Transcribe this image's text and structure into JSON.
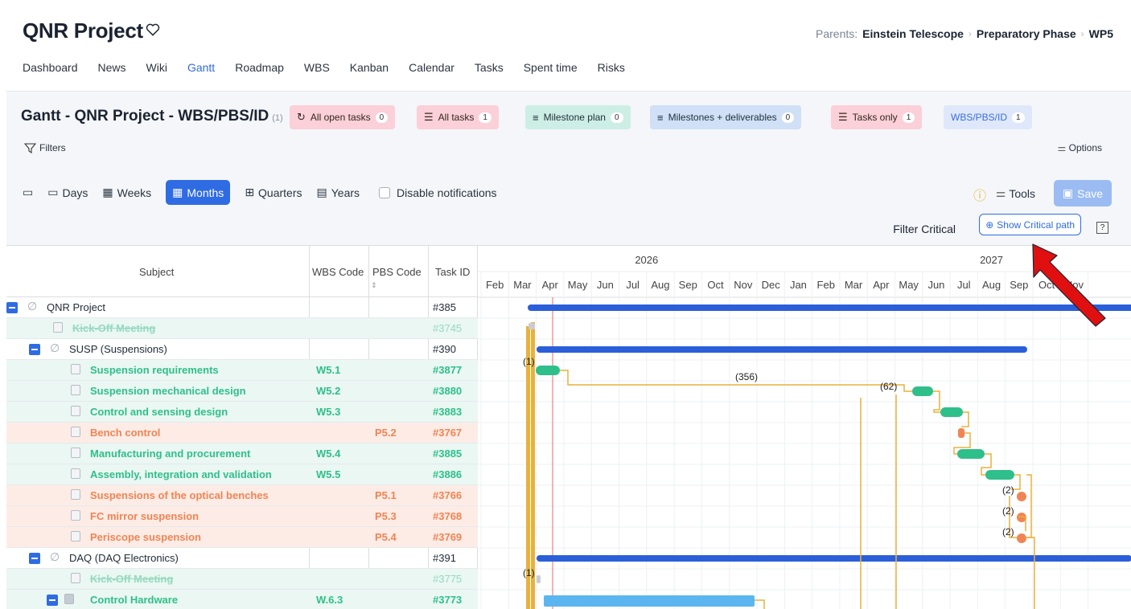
{
  "project": {
    "title": "QNR Project"
  },
  "parents": {
    "label": "Parents:",
    "items": [
      "Einstein Telescope",
      "Preparatory Phase",
      "WP5"
    ]
  },
  "nav": [
    "Dashboard",
    "News",
    "Wiki",
    "Gantt",
    "Roadmap",
    "WBS",
    "Kanban",
    "Calendar",
    "Tasks",
    "Spent time",
    "Risks"
  ],
  "nav_active": "Gantt",
  "gantt": {
    "title": "Gantt - QNR Project - WBS/PBS/ID",
    "title_count": "(1)",
    "queries": [
      {
        "label": "All open tasks",
        "count": "0",
        "style": "pink",
        "icon": "refresh-icon"
      },
      {
        "label": "All tasks",
        "count": "1",
        "style": "pink",
        "icon": "list-icon"
      },
      {
        "label": "Milestone plan",
        "count": "0",
        "style": "mint",
        "icon": "filter-list-icon"
      },
      {
        "label": "Milestones + deliverables",
        "count": "0",
        "style": "blue",
        "icon": "filter-list-icon"
      },
      {
        "label": "Tasks only",
        "count": "1",
        "style": "pink",
        "icon": "list-icon"
      },
      {
        "label": "WBS/PBS/ID",
        "count": "1",
        "style": "wbs",
        "icon": ""
      }
    ],
    "filters_label": "Filters",
    "options_label": "Options",
    "zoom": {
      "days": "Days",
      "weeks": "Weeks",
      "months": "Months",
      "quarters": "Quarters",
      "years": "Years",
      "active": "Months"
    },
    "disable_notifications": "Disable notifications",
    "tools_label": "Tools",
    "save_label": "Save",
    "filter_critical": "Filter Critical",
    "show_critical": "Show Critical path",
    "help": "?",
    "columns": {
      "subject": "Subject",
      "wbs": "WBS Code",
      "pbs": "PBS Code",
      "task_id": "Task ID"
    },
    "years": [
      "2026",
      "2027"
    ],
    "months": [
      "Feb",
      "Mar",
      "Apr",
      "May",
      "Jun",
      "Jul",
      "Aug",
      "Sep",
      "Oct",
      "Nov",
      "Dec",
      "Jan",
      "Feb",
      "Mar",
      "Apr",
      "May",
      "Jun",
      "Jul",
      "Aug",
      "Sep",
      "Oct",
      "Nov"
    ],
    "rows": [
      {
        "subject": "QNR Project",
        "wbs": "",
        "pbs": "",
        "id": "#385",
        "level": 0,
        "kind": "parent",
        "style": "plain"
      },
      {
        "subject": "Kick-Off Meeting",
        "wbs": "",
        "pbs": "",
        "id": "#3745",
        "level": 1,
        "kind": "task",
        "style": "strike"
      },
      {
        "subject": "SUSP (Suspensions)",
        "wbs": "",
        "pbs": "",
        "id": "#390",
        "level": 1,
        "kind": "parent",
        "style": "plain"
      },
      {
        "subject": "Suspension requirements",
        "wbs": "W5.1",
        "pbs": "",
        "id": "#3877",
        "level": 2,
        "kind": "task",
        "style": "green"
      },
      {
        "subject": "Suspension mechanical design",
        "wbs": "W5.2",
        "pbs": "",
        "id": "#3880",
        "level": 2,
        "kind": "task",
        "style": "green"
      },
      {
        "subject": "Control and sensing design",
        "wbs": "W5.3",
        "pbs": "",
        "id": "#3883",
        "level": 2,
        "kind": "task",
        "style": "green"
      },
      {
        "subject": "Bench control",
        "wbs": "",
        "pbs": "P5.2",
        "id": "#3767",
        "level": 2,
        "kind": "task",
        "style": "orange"
      },
      {
        "subject": "Manufacturing and procurement",
        "wbs": "W5.4",
        "pbs": "",
        "id": "#3885",
        "level": 2,
        "kind": "task",
        "style": "green"
      },
      {
        "subject": "Assembly, integration and validation",
        "wbs": "W5.5",
        "pbs": "",
        "id": "#3886",
        "level": 2,
        "kind": "task",
        "style": "green"
      },
      {
        "subject": "Suspensions of the optical benches",
        "wbs": "",
        "pbs": "P5.1",
        "id": "#3766",
        "level": 2,
        "kind": "task",
        "style": "orange"
      },
      {
        "subject": "FC mirror suspension",
        "wbs": "",
        "pbs": "P5.3",
        "id": "#3768",
        "level": 2,
        "kind": "task",
        "style": "orange"
      },
      {
        "subject": "Periscope suspension",
        "wbs": "",
        "pbs": "P5.4",
        "id": "#3769",
        "level": 2,
        "kind": "task",
        "style": "orange"
      },
      {
        "subject": "DAQ (DAQ Electronics)",
        "wbs": "",
        "pbs": "",
        "id": "#391",
        "level": 1,
        "kind": "parent",
        "style": "plain"
      },
      {
        "subject": "Kick-Off Meeting",
        "wbs": "",
        "pbs": "",
        "id": "#3775",
        "level": 2,
        "kind": "task",
        "style": "strike"
      },
      {
        "subject": "Control Hardware",
        "wbs": "W.6.3",
        "pbs": "",
        "id": "#3773",
        "level": 2,
        "kind": "folder",
        "style": "green"
      }
    ],
    "lag_labels": [
      "(1)",
      "(356)",
      "(62)",
      "(2)",
      "(2)",
      "(2)",
      "(1)"
    ]
  },
  "colors": {
    "accent": "#2f6be3",
    "green": "#2fbf8a",
    "orange": "#f08454",
    "bar_blue": "#2b5fd9",
    "link": "#e9b13c",
    "today": "#f26464",
    "arrow": "#e01010"
  }
}
